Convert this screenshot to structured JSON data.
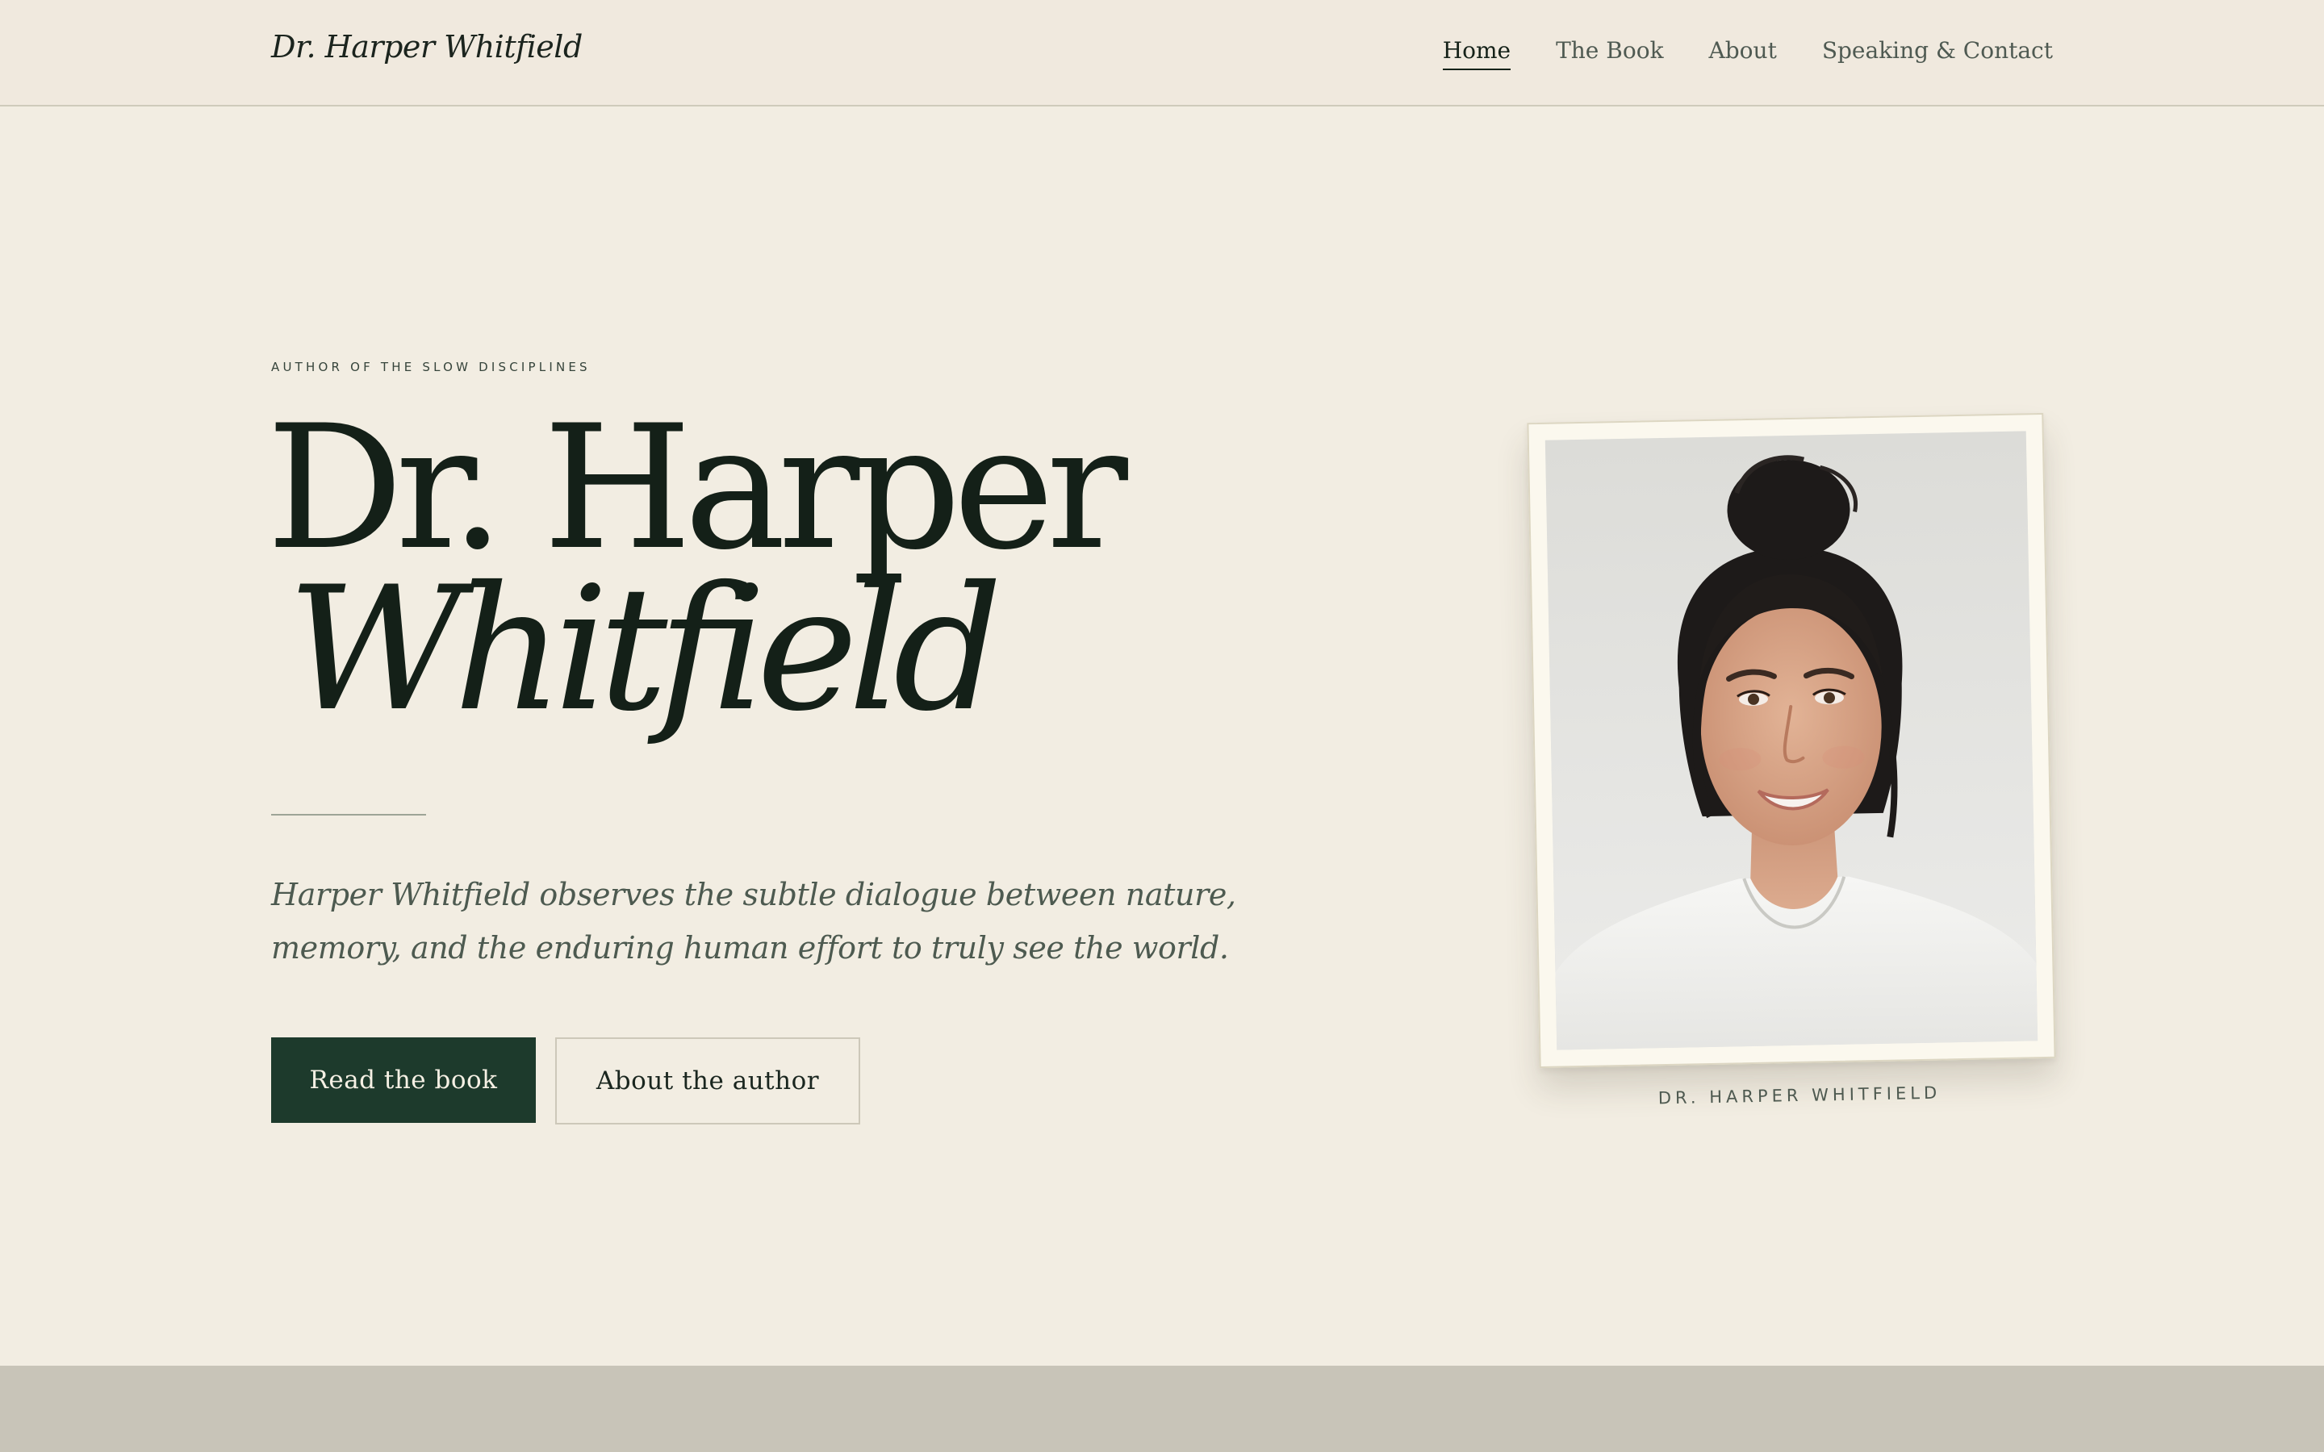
{
  "header": {
    "brand": "Dr. Harper Whitfield",
    "nav": [
      {
        "label": "Home",
        "active": true
      },
      {
        "label": "The Book",
        "active": false
      },
      {
        "label": "About",
        "active": false
      },
      {
        "label": "Speaking & Contact",
        "active": false
      }
    ]
  },
  "hero": {
    "eyebrow": "AUTHOR OF THE SLOW DISCIPLINES",
    "title_line1": "Dr. Harper",
    "title_line2": "Whitfield",
    "lede": "Harper Whitfield observes the subtle dialogue between nature, memory, and the enduring human effort to truly see the world.",
    "primary_button": "Read the book",
    "secondary_button": "About the author"
  },
  "portrait": {
    "caption": "DR. HARPER WHITFIELD",
    "image_icon": "author-portrait-photo"
  },
  "colors": {
    "background": "#f2ede2",
    "header_background": "#f0e9de",
    "accent_green": "#1d3a2c",
    "text_dark": "#142018",
    "text_muted": "#4d5a50",
    "bottom_band": "#c8c4b8"
  }
}
